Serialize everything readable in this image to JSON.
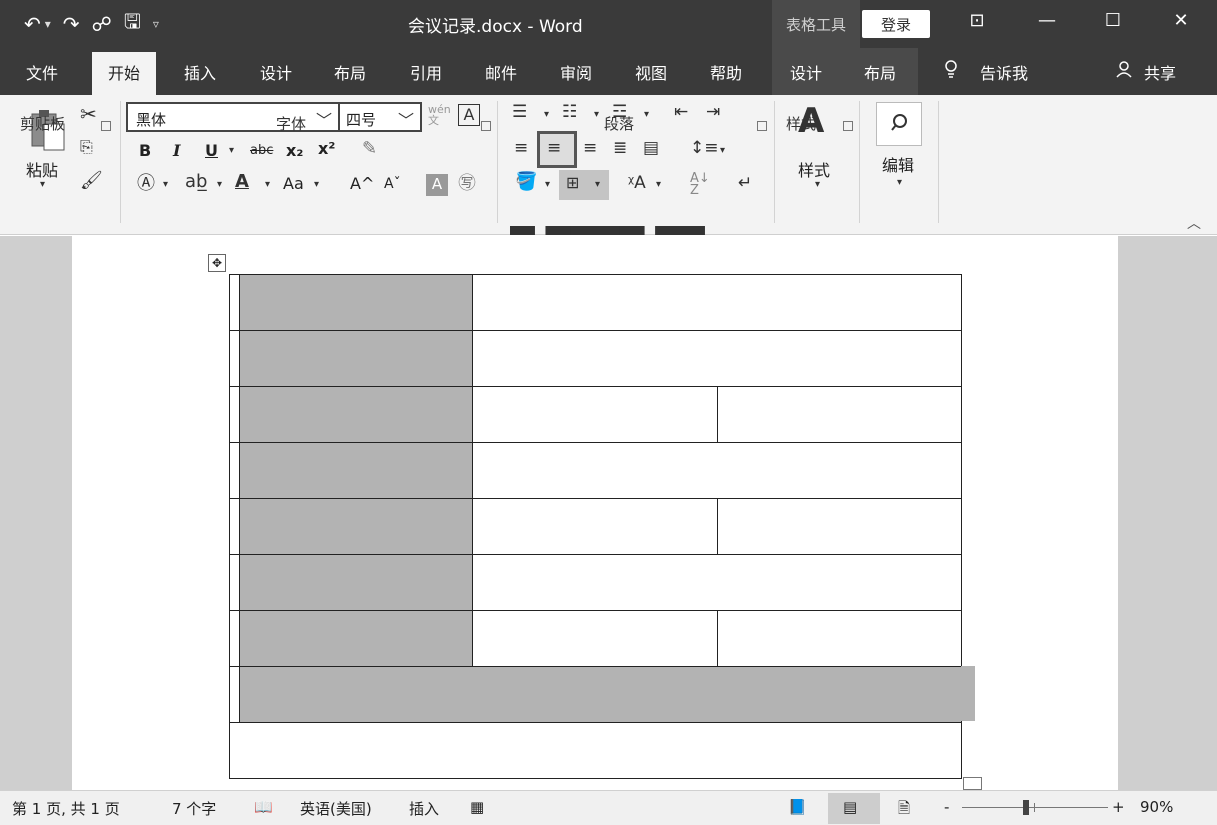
{
  "app": {
    "doc_title": "会议记录.docx  -  Word",
    "context_tools_label": "表格工具",
    "login_label": "登录"
  },
  "qat": {
    "undo": "↶",
    "dropdown": "▾",
    "redo": "↷",
    "touch": "☍",
    "save": "🖫",
    "customize": "▿"
  },
  "window_controls": {
    "ribbon_display": "⊡",
    "minimize": "—",
    "maximize": "☐",
    "close": "✕"
  },
  "tabs": {
    "file": "文件",
    "home": "开始",
    "insert": "插入",
    "design": "设计",
    "layout": "布局",
    "references": "引用",
    "mailings": "邮件",
    "review": "审阅",
    "view": "视图",
    "help": "帮助",
    "table_design": "设计",
    "table_layout": "布局",
    "tell_me": "告诉我",
    "share": "共享"
  },
  "ribbon": {
    "clipboard": {
      "paste_label": "粘贴",
      "group_label": "剪贴板"
    },
    "font": {
      "font_name": "黑体",
      "font_size": "四号",
      "bold": "B",
      "italic": "I",
      "underline": "U",
      "strike": "abc",
      "subscript": "x₂",
      "superscript": "x²",
      "change_case": "Aa",
      "grow_font": "A^",
      "shrink_font": "Aˇ",
      "group_label": "字体"
    },
    "paragraph": {
      "group_label": "段落"
    },
    "styles": {
      "button_label": "样式",
      "group_label": "样式"
    },
    "editing": {
      "button_label": "编辑"
    }
  },
  "document": {
    "table": {
      "rows": 9,
      "shaded_label_column": true
    }
  },
  "statusbar": {
    "page_info": "第 1 页, 共 1 页",
    "word_count": "7 个字",
    "language": "英语(美国)",
    "mode": "插入",
    "zoom_minus": "-",
    "zoom_plus": "+",
    "zoom_percent": "90%"
  },
  "colors": {
    "titlebar": "#3a3a3a",
    "ribbon": "#f3f3f3",
    "cell_shade": "#b3b3b3"
  }
}
